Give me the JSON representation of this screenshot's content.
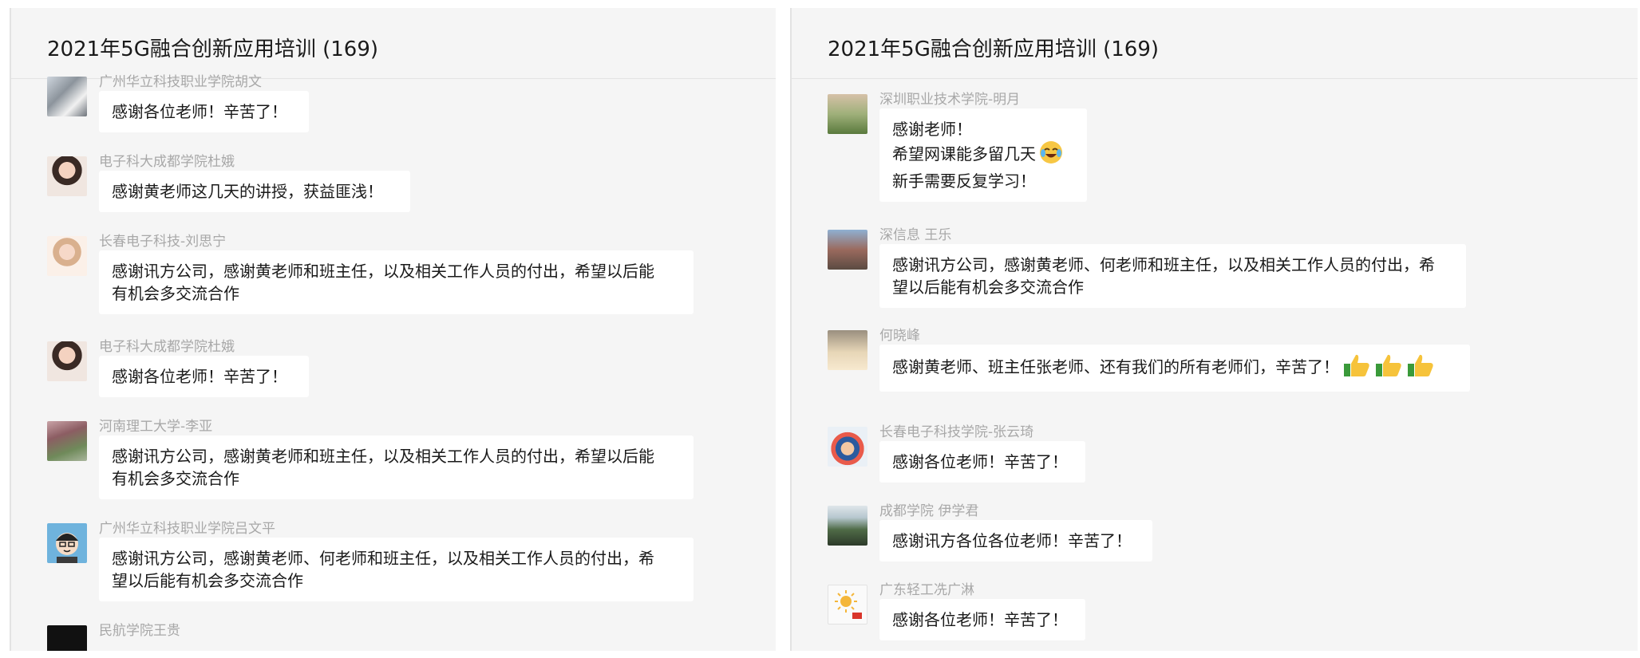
{
  "left_panel": {
    "title": "2021年5G融合创新应用培训 (169)",
    "messages": [
      {
        "sender": "广州华立科技职业学院胡文",
        "lines": [
          "感谢各位老师！辛苦了！"
        ]
      },
      {
        "sender": "电子科大成都学院杜娥",
        "lines": [
          "感谢黄老师这几天的讲授，获益匪浅！"
        ]
      },
      {
        "sender": "长春电子科技-刘思宁",
        "lines": [
          "感谢讯方公司，感谢黄老师和班主任，以及相关工作人员的付出，希望以后能",
          "有机会多交流合作"
        ]
      },
      {
        "sender": "电子科大成都学院杜娥",
        "lines": [
          "感谢各位老师！辛苦了！"
        ]
      },
      {
        "sender": "河南理工大学-李亚",
        "lines": [
          "感谢讯方公司，感谢黄老师和班主任，以及相关工作人员的付出，希望以后能",
          "有机会多交流合作"
        ]
      },
      {
        "sender": "广州华立科技职业学院吕文平",
        "lines": [
          "感谢讯方公司，感谢黄老师、何老师和班主任，以及相关工作人员的付出，希",
          "望以后能有机会多交流合作"
        ]
      },
      {
        "sender": "民航学院王贵"
      }
    ]
  },
  "right_panel": {
    "title": "2021年5G融合创新应用培训 (169)",
    "messages": [
      {
        "sender": "深圳职业技术学院-明月",
        "lines": [
          "感谢老师！",
          "希望网课能多留几天",
          "新手需要反复学习！"
        ],
        "emoji": "laughing-tears-emoji"
      },
      {
        "sender": "深信息 王乐",
        "lines": [
          "感谢讯方公司，感谢黄老师、何老师和班主任，以及相关工作人员的付出，希",
          "望以后能有机会多交流合作"
        ]
      },
      {
        "sender": "何晓峰",
        "lines": [
          "感谢黄老师、班主任张老师、还有我们的所有老师们，辛苦了！"
        ],
        "emoji": "thumbs-up-emoji"
      },
      {
        "sender": "长春电子科技学院-张云琦",
        "lines": [
          "感谢各位老师！辛苦了！"
        ]
      },
      {
        "sender": "成都学院 伊学君",
        "lines": [
          "感谢讯方各位各位老师！辛苦了！"
        ]
      },
      {
        "sender": "广东轻工冼广淋",
        "lines": [
          "感谢各位老师！辛苦了！"
        ]
      }
    ]
  }
}
